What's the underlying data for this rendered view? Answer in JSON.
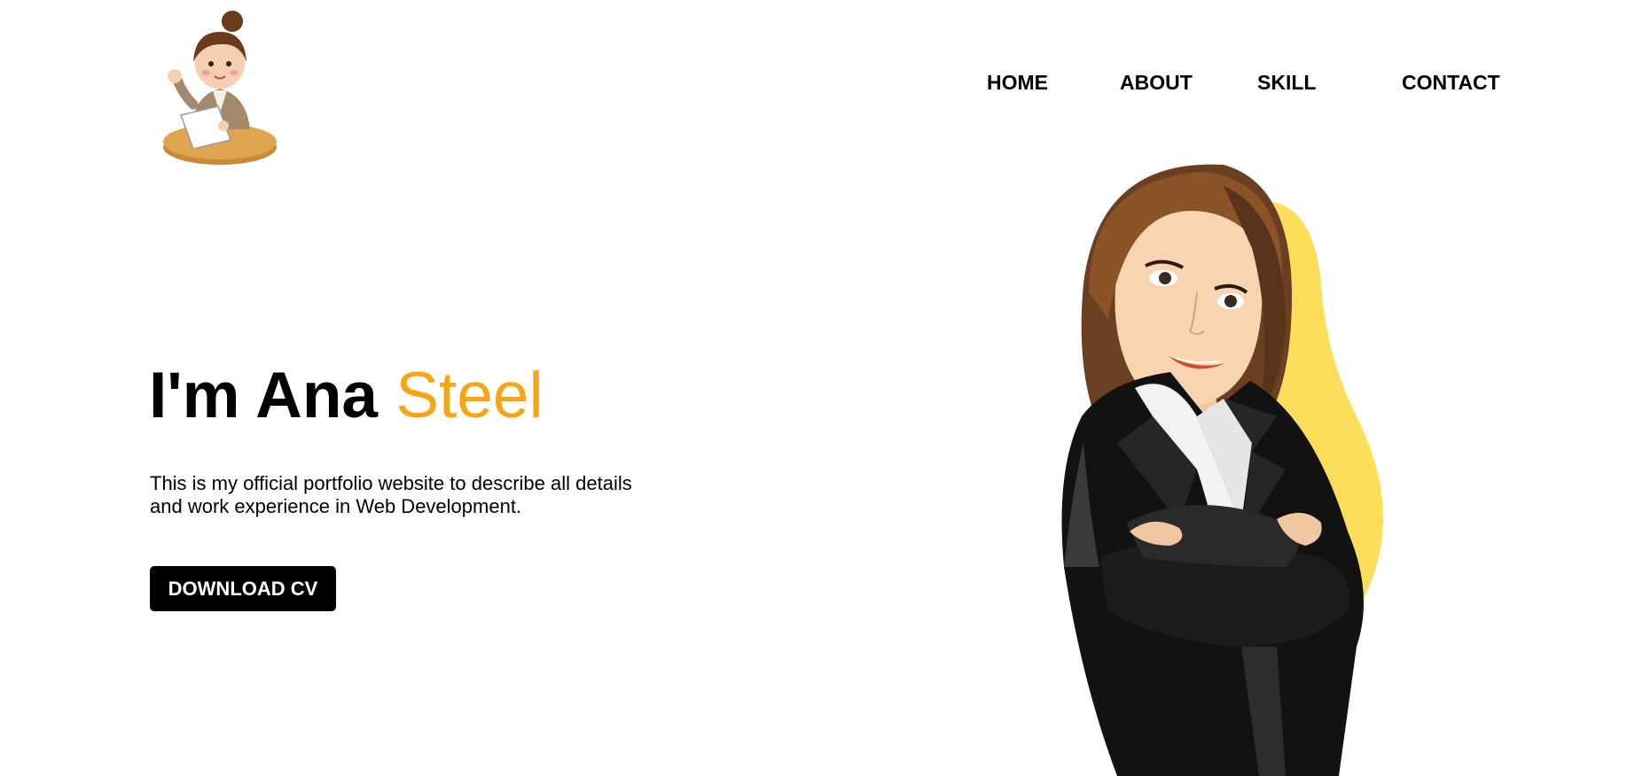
{
  "nav": {
    "items": [
      {
        "label": "HOME"
      },
      {
        "label": "ABOUT"
      },
      {
        "label": "SKILL"
      },
      {
        "label": "CONTACT"
      }
    ]
  },
  "hero": {
    "title_main": "I'm Ana ",
    "title_accent": "Steel",
    "description": "This is my official portfolio website to describe all details and work experience in Web Development.",
    "button_label": "DOWNLOAD CV"
  },
  "colors": {
    "accent": "#f6a614",
    "blob": "#fedd5a",
    "button_bg": "#000000",
    "button_text": "#ffffff"
  },
  "icons": {
    "logo": "woman-at-table-logo-icon",
    "hero_image": "businesswoman-illustration"
  }
}
